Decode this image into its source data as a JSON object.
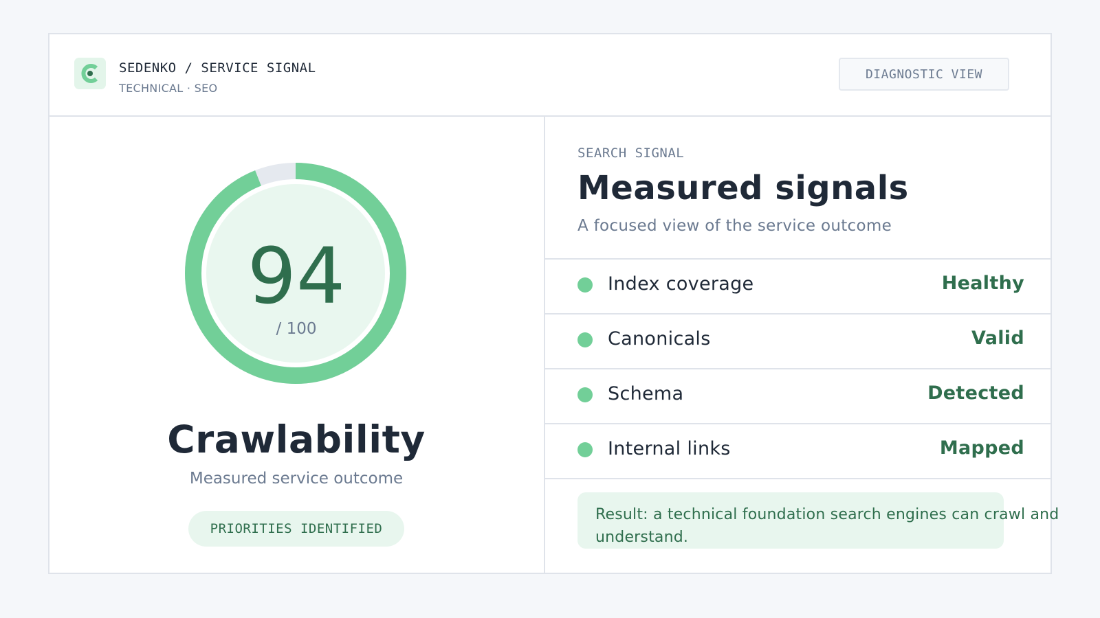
{
  "header": {
    "brand": "SEDENKO / SERVICE SIGNAL",
    "subtitle": "TECHNICAL · SEO",
    "view_button": "DIAGNOSTIC VIEW"
  },
  "score_card": {
    "score": "94",
    "score_max": "/ 100",
    "score_fraction": 0.94,
    "title": "Crawlability",
    "subtitle": "Measured service outcome",
    "badge": "PRIORITIES IDENTIFIED"
  },
  "signals_panel": {
    "eyebrow": "SEARCH SIGNAL",
    "title": "Measured signals",
    "subtitle": "A focused view of the service outcome",
    "items": [
      {
        "label": "Index coverage",
        "status": "Healthy"
      },
      {
        "label": "Canonicals",
        "status": "Valid"
      },
      {
        "label": "Schema",
        "status": "Detected"
      },
      {
        "label": "Internal links",
        "status": "Mapped"
      }
    ],
    "result_line1": "Result: a technical foundation search engines can crawl and",
    "result_line2": "understand."
  },
  "colors": {
    "accent": "#72cf98",
    "accent_dark": "#2f6e4d",
    "accent_soft": "#e8f6ee",
    "track": "#e5e9ef",
    "text": "#1f2937",
    "muted": "#6b7a90"
  },
  "icons": {
    "logo": "c-logo-icon",
    "status_dot": "status-dot-icon"
  }
}
